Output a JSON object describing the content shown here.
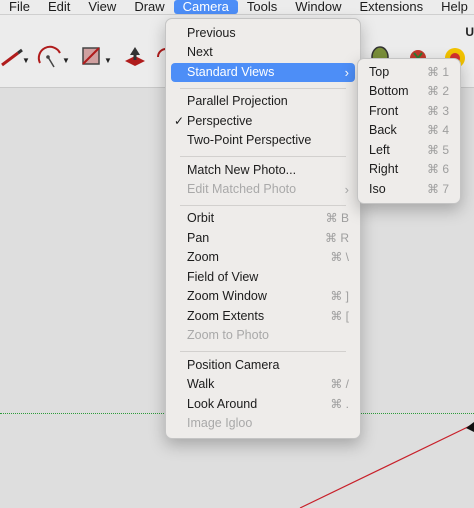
{
  "menubar": {
    "items": [
      "File",
      "Edit",
      "View",
      "Draw",
      "Camera",
      "Tools",
      "Window",
      "Extensions",
      "Help"
    ],
    "active": "Camera"
  },
  "toolbar": {
    "label": "U",
    "tools": [
      "pencil-tool",
      "arc-tool",
      "shapes-tool",
      "push-pull-tool"
    ]
  },
  "camera_menu": {
    "previous": "Previous",
    "next": "Next",
    "standard_views": "Standard Views",
    "parallel_projection": "Parallel Projection",
    "perspective": "Perspective",
    "perspective_check": "✓",
    "two_point": "Two-Point Perspective",
    "match_new_photo": "Match New Photo...",
    "edit_matched_photo": "Edit Matched Photo",
    "orbit": "Orbit",
    "orbit_sc": "⌘ B",
    "pan": "Pan",
    "pan_sc": "⌘ R",
    "zoom": "Zoom",
    "zoom_sc": "⌘ \\",
    "field_of_view": "Field of View",
    "zoom_window": "Zoom Window",
    "zoom_window_sc": "⌘ ]",
    "zoom_extents": "Zoom Extents",
    "zoom_extents_sc": "⌘ [",
    "zoom_to_photo": "Zoom to Photo",
    "position_camera": "Position Camera",
    "walk": "Walk",
    "walk_sc": "⌘ /",
    "look_around": "Look Around",
    "look_around_sc": "⌘ .",
    "image_igloo": "Image Igloo"
  },
  "standard_views_menu": {
    "top": "Top",
    "top_sc": "⌘ 1",
    "bottom": "Bottom",
    "bottom_sc": "⌘ 2",
    "front": "Front",
    "front_sc": "⌘ 3",
    "back": "Back",
    "back_sc": "⌘ 4",
    "left": "Left",
    "left_sc": "⌘ 5",
    "right": "Right",
    "right_sc": "⌘ 6",
    "iso": "Iso",
    "iso_sc": "⌘ 7"
  },
  "colors": {
    "highlight": "#4d8ef7",
    "axis_green": "#2e9b3a",
    "axis_red": "#c8202a"
  }
}
